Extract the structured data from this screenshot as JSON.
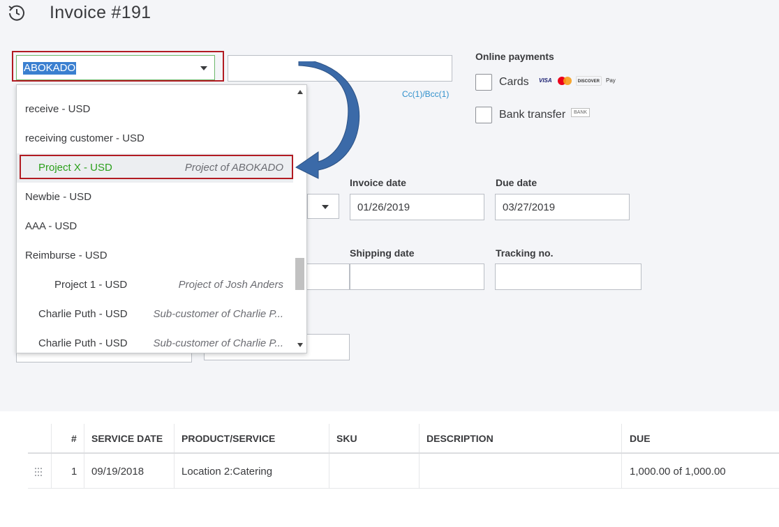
{
  "header": {
    "title": "Invoice #191",
    "history_icon": "history-clock-icon"
  },
  "customer": {
    "selected_value": "ABOKADO"
  },
  "email": {
    "value": "",
    "cc_link": "Cc(1)/Bcc(1)"
  },
  "online_payments": {
    "title": "Online payments",
    "options": [
      {
        "label": "Cards",
        "checked": false,
        "logos": [
          "VISA",
          "MC",
          "DISCOVER",
          "Pay"
        ]
      },
      {
        "label": "Bank transfer",
        "checked": false,
        "badge": "BANK"
      }
    ]
  },
  "dropdown": {
    "items": [
      {
        "name": "receive - USD",
        "sub": "",
        "indent": 0
      },
      {
        "name": "receiving customer - USD",
        "sub": "",
        "indent": 0
      },
      {
        "name": "Project X - USD",
        "sub": "Project of ABOKADO",
        "indent": 1,
        "selected": true
      },
      {
        "name": "Newbie - USD",
        "sub": "",
        "indent": 0
      },
      {
        "name": "AAA - USD",
        "sub": "",
        "indent": 0
      },
      {
        "name": "Reimburse - USD",
        "sub": "",
        "indent": 0
      },
      {
        "name": "Project 1 - USD",
        "sub": "Project of Josh Anders",
        "indent": 2
      },
      {
        "name": "Charlie Puth - USD",
        "sub": "Sub-customer of Charlie P...",
        "indent": 1
      },
      {
        "name": "Charlie Puth - USD",
        "sub": "Sub-customer of Charlie P...",
        "indent": 1
      }
    ]
  },
  "fields": {
    "invoice_date": {
      "label": "Invoice date",
      "value": "01/26/2019"
    },
    "due_date": {
      "label": "Due date",
      "value": "03/27/2019"
    },
    "shipping_date": {
      "label": "Shipping date",
      "value": ""
    },
    "tracking_no": {
      "label": "Tracking no.",
      "value": ""
    }
  },
  "table": {
    "columns": [
      "#",
      "SERVICE DATE",
      "PRODUCT/SERVICE",
      "SKU",
      "DESCRIPTION",
      "DUE"
    ],
    "rows": [
      {
        "num": "1",
        "service_date": "09/19/2018",
        "product": "Location 2:Catering",
        "sku": "",
        "description": "",
        "due": "1,000.00 of 1,000.00"
      }
    ]
  },
  "colors": {
    "highlight": "#b21b22",
    "accent_green": "#2ca01c",
    "link_blue": "#2f8fcb",
    "arrow_blue": "#3b6aa8"
  }
}
